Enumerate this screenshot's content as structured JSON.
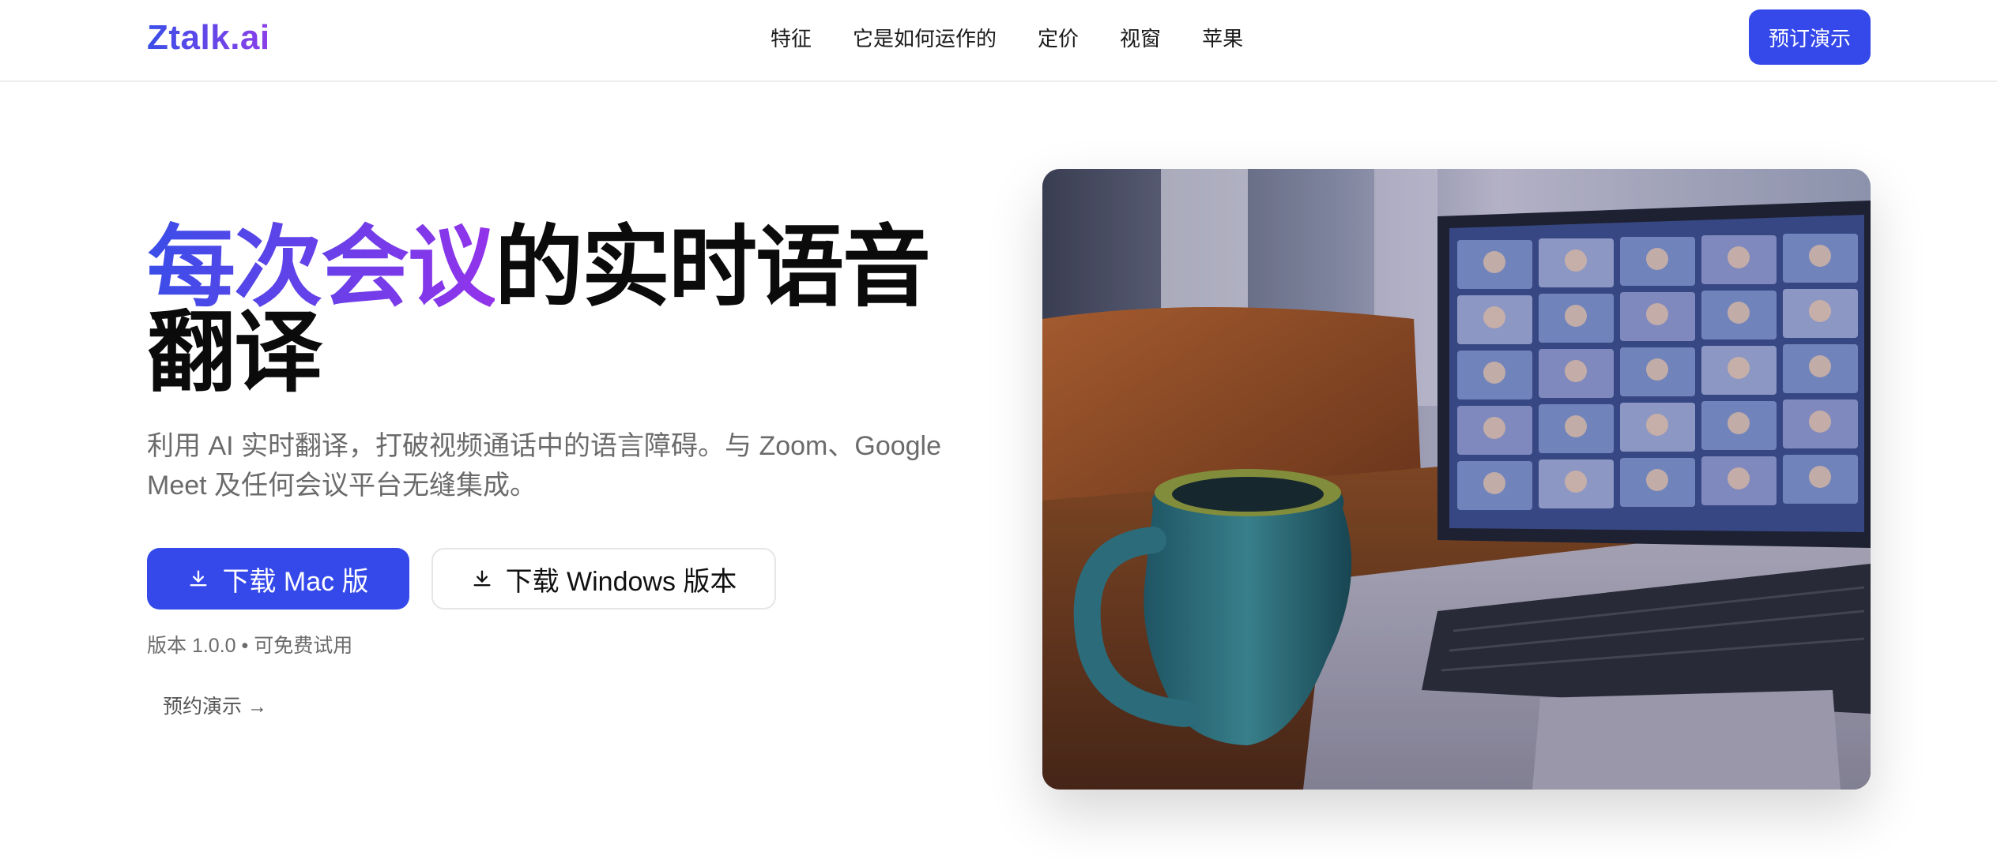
{
  "header": {
    "logo": "Ztalk.ai",
    "nav": [
      "特征",
      "它是如何运作的",
      "定价",
      "视窗",
      "苹果"
    ],
    "cta_label": "预订演示"
  },
  "hero": {
    "headline_highlight": "每次会议",
    "headline_rest": "的实时语音翻译",
    "subtitle": "利用 AI 实时翻译，打破视频通话中的语言障碍。与 Zoom、Google Meet 及任何会议平台无缝集成。",
    "download_mac": "下载 Mac 版",
    "download_windows": "下载 Windows 版本",
    "version_info": "版本 1.0.0 • 可免费试用",
    "demo_link": "预约演示 →"
  },
  "colors": {
    "brand": "#3549ea",
    "gradient_end": "#9333ea"
  }
}
